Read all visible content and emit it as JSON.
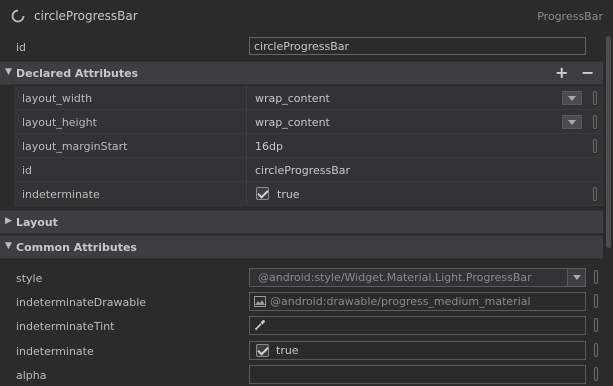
{
  "header": {
    "component_name": "circleProgressBar",
    "component_type": "ProgressBar"
  },
  "id_field": {
    "label": "id",
    "value": "circleProgressBar"
  },
  "declared_attributes": {
    "title": "Declared Attributes",
    "add_label": "+",
    "remove_label": "−",
    "rows": [
      {
        "label": "layout_width",
        "value": "wrap_content",
        "has_dropdown": true
      },
      {
        "label": "layout_height",
        "value": "wrap_content",
        "has_dropdown": true
      },
      {
        "label": "layout_marginStart",
        "value": "16dp",
        "has_dropdown": false
      },
      {
        "label": "id",
        "value": "circleProgressBar",
        "has_dropdown": false
      },
      {
        "label": "indeterminate",
        "value": "true",
        "checked": true
      }
    ]
  },
  "layout_section": {
    "title": "Layout"
  },
  "common_attributes": {
    "title": "Common Attributes",
    "rows": [
      {
        "label": "style",
        "value": "@android:style/Widget.Material.Light.ProgressBar",
        "icon": "chevron-down-icon"
      },
      {
        "label": "indeterminateDrawable",
        "value": "@android:drawable/progress_medium_material",
        "icon": "image-icon"
      },
      {
        "label": "indeterminateTint",
        "value": "",
        "icon": "eyedropper-icon"
      },
      {
        "label": "indeterminate",
        "value": "true",
        "checked": true
      },
      {
        "label": "alpha",
        "value": ""
      }
    ]
  },
  "colors": {
    "background": "#2b2b2b",
    "section_header": "#3c3f41",
    "text": "#bbbbbb",
    "muted_text": "#8a8a8a"
  }
}
